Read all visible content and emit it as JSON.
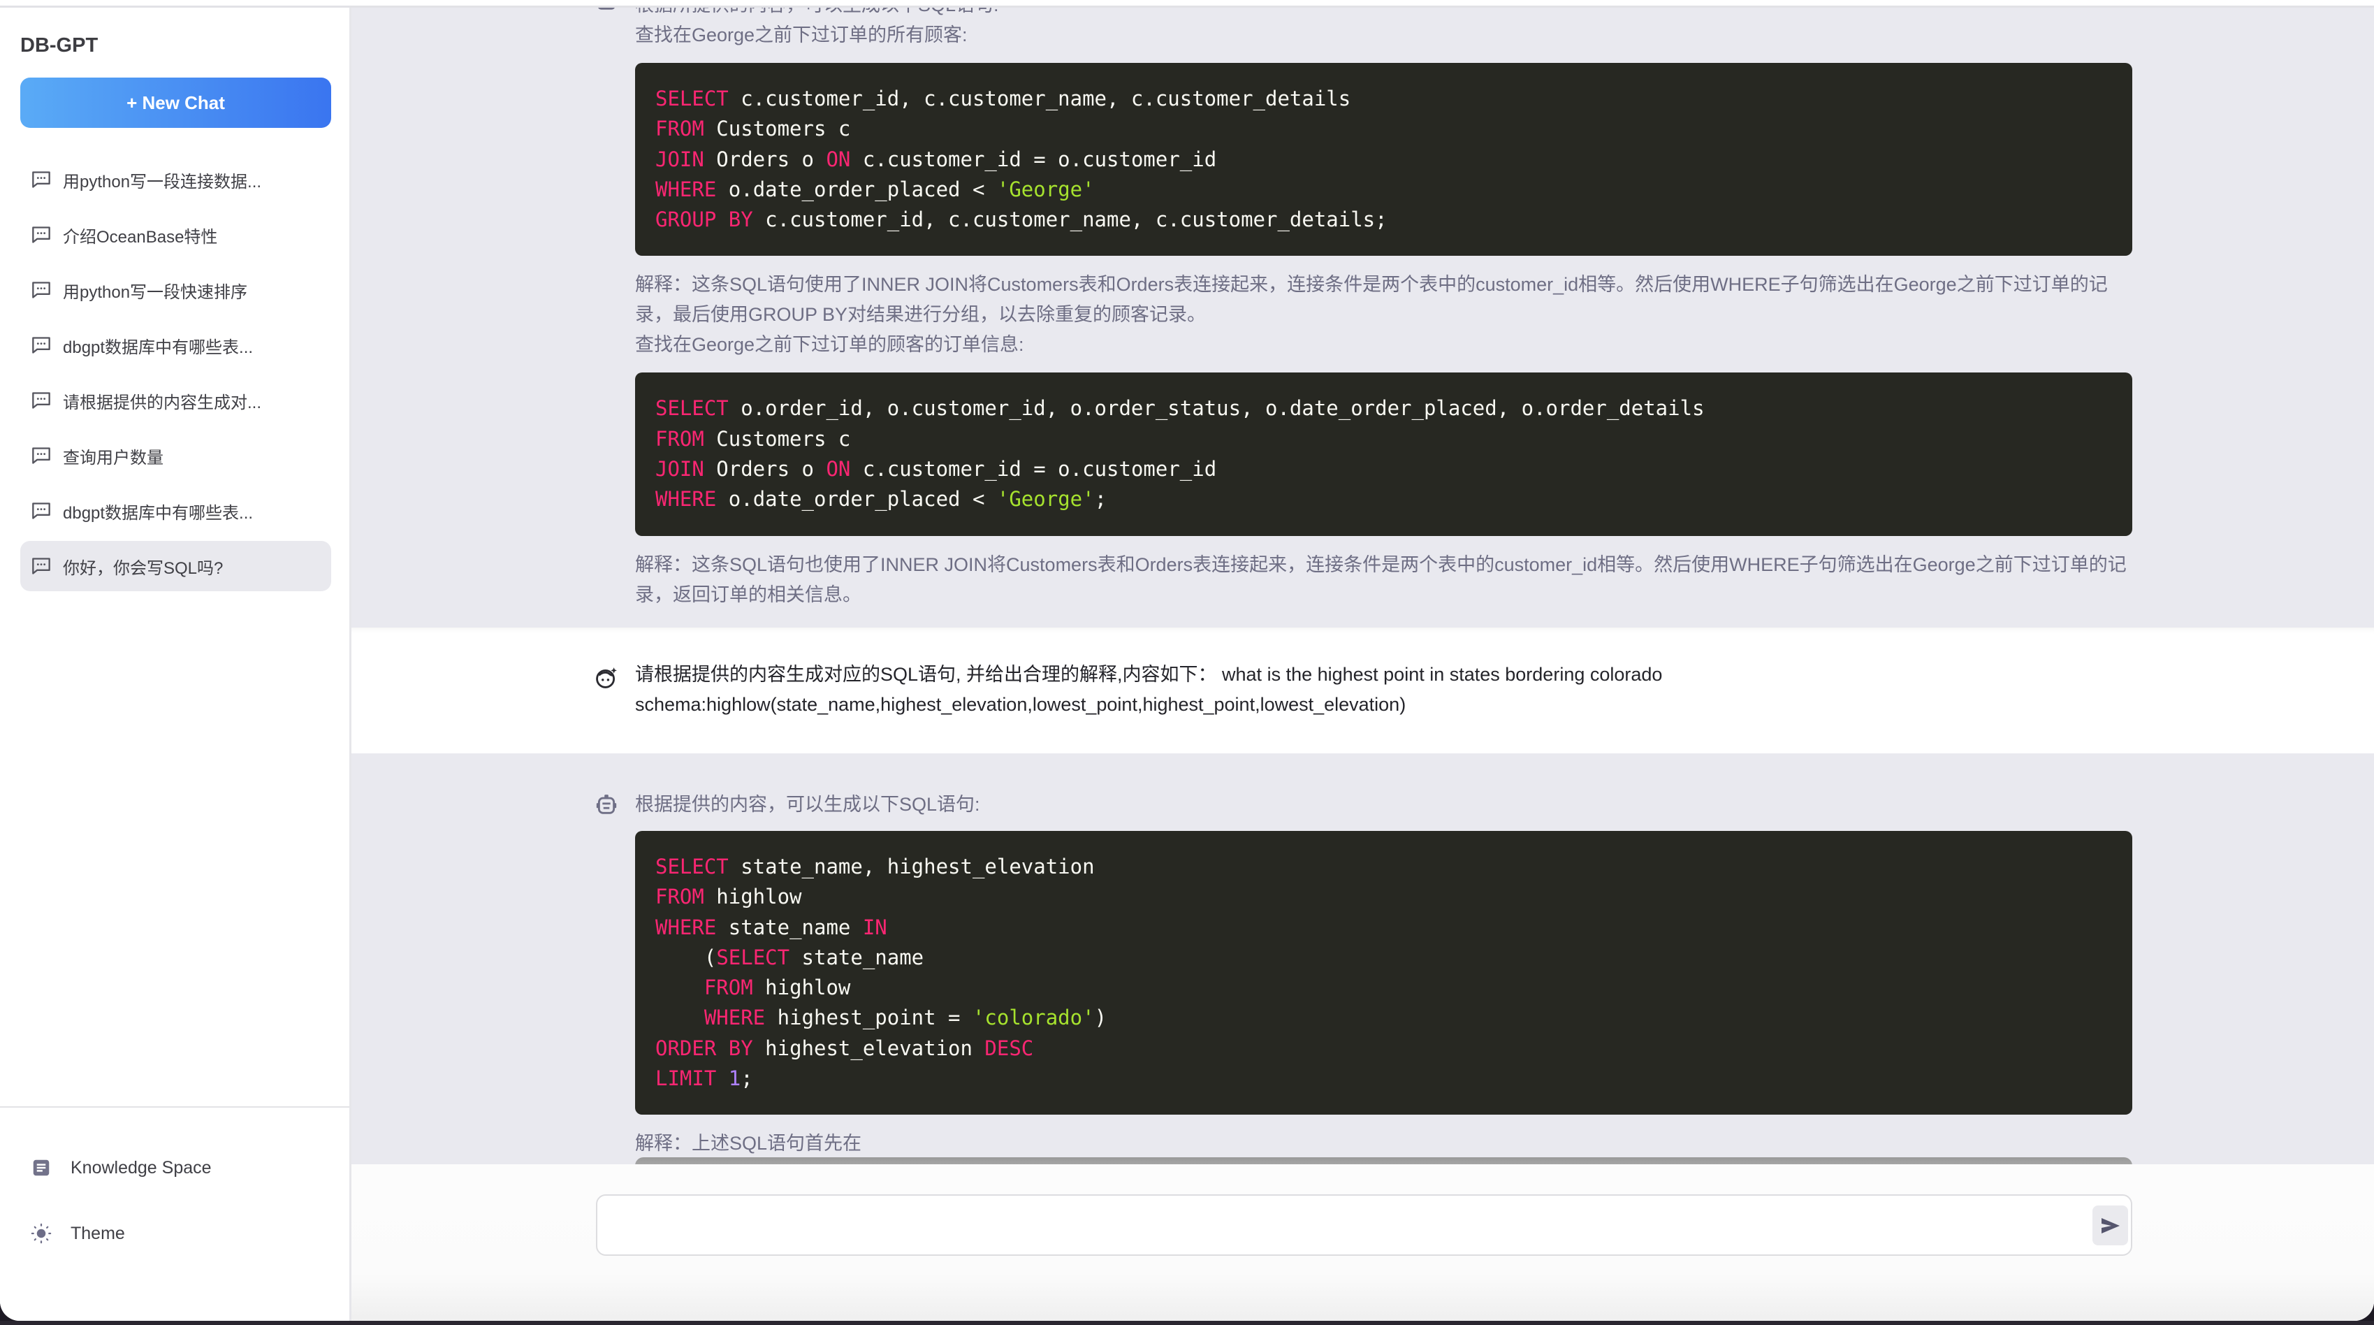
{
  "sidebar": {
    "brand": "DB-GPT",
    "new_chat_label": "+ New Chat",
    "chats": [
      {
        "label": "用python写一段连接数据...",
        "active": false
      },
      {
        "label": "介绍OceanBase特性",
        "active": false
      },
      {
        "label": "用python写一段快速排序",
        "active": false
      },
      {
        "label": "dbgpt数据库中有哪些表...",
        "active": false
      },
      {
        "label": "请根据提供的内容生成对...",
        "active": false
      },
      {
        "label": "查询用户数量",
        "active": false
      },
      {
        "label": "dbgpt数据库中有哪些表...",
        "active": false
      },
      {
        "label": "你好，你会写SQL吗?",
        "active": true
      }
    ],
    "knowledge_space_label": "Knowledge Space",
    "theme_label": "Theme"
  },
  "conversation": {
    "assistant_1": {
      "intro_cut": "根据所提供的内容，可以生成以下SQL语句:",
      "heading_1": "查找在George之前下过订单的所有顾客:",
      "code_1": [
        [
          [
            "kw",
            "SELECT"
          ],
          [
            "t",
            " c.customer_id, c.customer_name, c.customer_details"
          ]
        ],
        [
          [
            "kw",
            "FROM"
          ],
          [
            "t",
            " Customers c"
          ]
        ],
        [
          [
            "kw",
            "JOIN"
          ],
          [
            "t",
            " Orders o "
          ],
          [
            "kw",
            "ON"
          ],
          [
            "t",
            " c.customer_id = o.customer_id"
          ]
        ],
        [
          [
            "kw",
            "WHERE"
          ],
          [
            "t",
            " o.date_order_placed < "
          ],
          [
            "str",
            "'George'"
          ]
        ],
        [
          [
            "kw",
            "GROUP BY"
          ],
          [
            "t",
            " c.customer_id, c.customer_name, c.customer_details;"
          ]
        ]
      ],
      "explain_1": "解释：这条SQL语句使用了INNER JOIN将Customers表和Orders表连接起来，连接条件是两个表中的customer_id相等。然后使用WHERE子句筛选出在George之前下过订单的记录，最后使用GROUP BY对结果进行分组，以去除重复的顾客记录。",
      "heading_2": "查找在George之前下过订单的顾客的订单信息:",
      "code_2": [
        [
          [
            "kw",
            "SELECT"
          ],
          [
            "t",
            " o.order_id, o.customer_id, o.order_status, o.date_order_placed, o.order_details"
          ]
        ],
        [
          [
            "kw",
            "FROM"
          ],
          [
            "t",
            " Customers c"
          ]
        ],
        [
          [
            "kw",
            "JOIN"
          ],
          [
            "t",
            " Orders o "
          ],
          [
            "kw",
            "ON"
          ],
          [
            "t",
            " c.customer_id = o.customer_id"
          ]
        ],
        [
          [
            "kw",
            "WHERE"
          ],
          [
            "t",
            " o.date_order_placed < "
          ],
          [
            "str",
            "'George'"
          ],
          [
            "t",
            ";"
          ]
        ]
      ],
      "explain_2": "解释：这条SQL语句也使用了INNER JOIN将Customers表和Orders表连接起来，连接条件是两个表中的customer_id相等。然后使用WHERE子句筛选出在George之前下过订单的记录，返回订单的相关信息。"
    },
    "user_1": {
      "line_1": "请根据提供的内容生成对应的SQL语句, 并给出合理的解释,内容如下：  what is the highest point in states bordering colorado",
      "line_2": "schema:highlow(state_name,highest_elevation,lowest_point,highest_point,lowest_elevation)"
    },
    "assistant_2": {
      "intro": "根据提供的内容，可以生成以下SQL语句:",
      "code": [
        [
          [
            "kw",
            "SELECT"
          ],
          [
            "t",
            " state_name, highest_elevation"
          ]
        ],
        [
          [
            "kw",
            "FROM"
          ],
          [
            "t",
            " highlow"
          ]
        ],
        [
          [
            "kw",
            "WHERE"
          ],
          [
            "t",
            " state_name "
          ],
          [
            "kw",
            "IN"
          ]
        ],
        [
          [
            "t",
            "    ("
          ],
          [
            "kw",
            "SELECT"
          ],
          [
            "t",
            " state_name"
          ]
        ],
        [
          [
            "t",
            "    "
          ],
          [
            "kw",
            "FROM"
          ],
          [
            "t",
            " highlow"
          ]
        ],
        [
          [
            "t",
            "    "
          ],
          [
            "kw",
            "WHERE"
          ],
          [
            "t",
            " highest_point = "
          ],
          [
            "str",
            "'colorado'"
          ],
          [
            "t",
            ")"
          ]
        ],
        [
          [
            "kw",
            "ORDER BY"
          ],
          [
            "t",
            " highest_elevation "
          ],
          [
            "kw",
            "DESC"
          ]
        ],
        [
          [
            "kw",
            "LIMIT"
          ],
          [
            "t",
            " "
          ],
          [
            "num",
            "1"
          ],
          [
            "t",
            ";"
          ]
        ]
      ],
      "explain_partial": "解释：上述SQL语句首先在"
    }
  },
  "input": {
    "value": "",
    "placeholder": ""
  },
  "colors": {
    "accent_start": "#5aabf6",
    "accent_end": "#3a75f0",
    "assistant_bg": "#e9e9ef",
    "code_bg": "#272822",
    "keyword": "#f92672",
    "string": "#a6e22e",
    "number": "#ae81ff"
  }
}
